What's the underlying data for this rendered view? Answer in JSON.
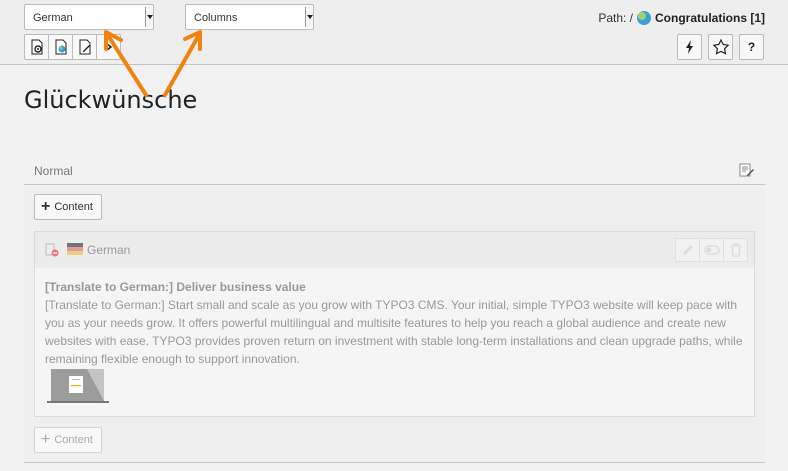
{
  "toolbar": {
    "language_select": {
      "value": "German"
    },
    "view_select": {
      "value": "Columns"
    },
    "path_label": "Path: /",
    "page_name": "Congratulations [1]",
    "help_label": "?"
  },
  "page": {
    "title": "Glückwünsche"
  },
  "column": {
    "name": "Normal",
    "add_content_label": "Content",
    "add_content_label_bottom": "Content"
  },
  "content_element": {
    "language": "German",
    "headline": "[Translate to German:] Deliver business value",
    "lines": [
      "[Translate to German:] Start small and scale as you grow with TYPO3 CMS. Your initial, simple TYPO3 website will keep pace with",
      "you as your needs grow. It offers powerful multilingual and multisite features to help you reach a global audience and create new",
      "websites with ease. TYPO3 provides proven return on investment with stable long-term installations and clean upgrade paths, while",
      "remaining flexible enough to support innovation."
    ]
  },
  "colors": {
    "arrow": "#f0830f",
    "page_bg": "#f2f2f2"
  }
}
